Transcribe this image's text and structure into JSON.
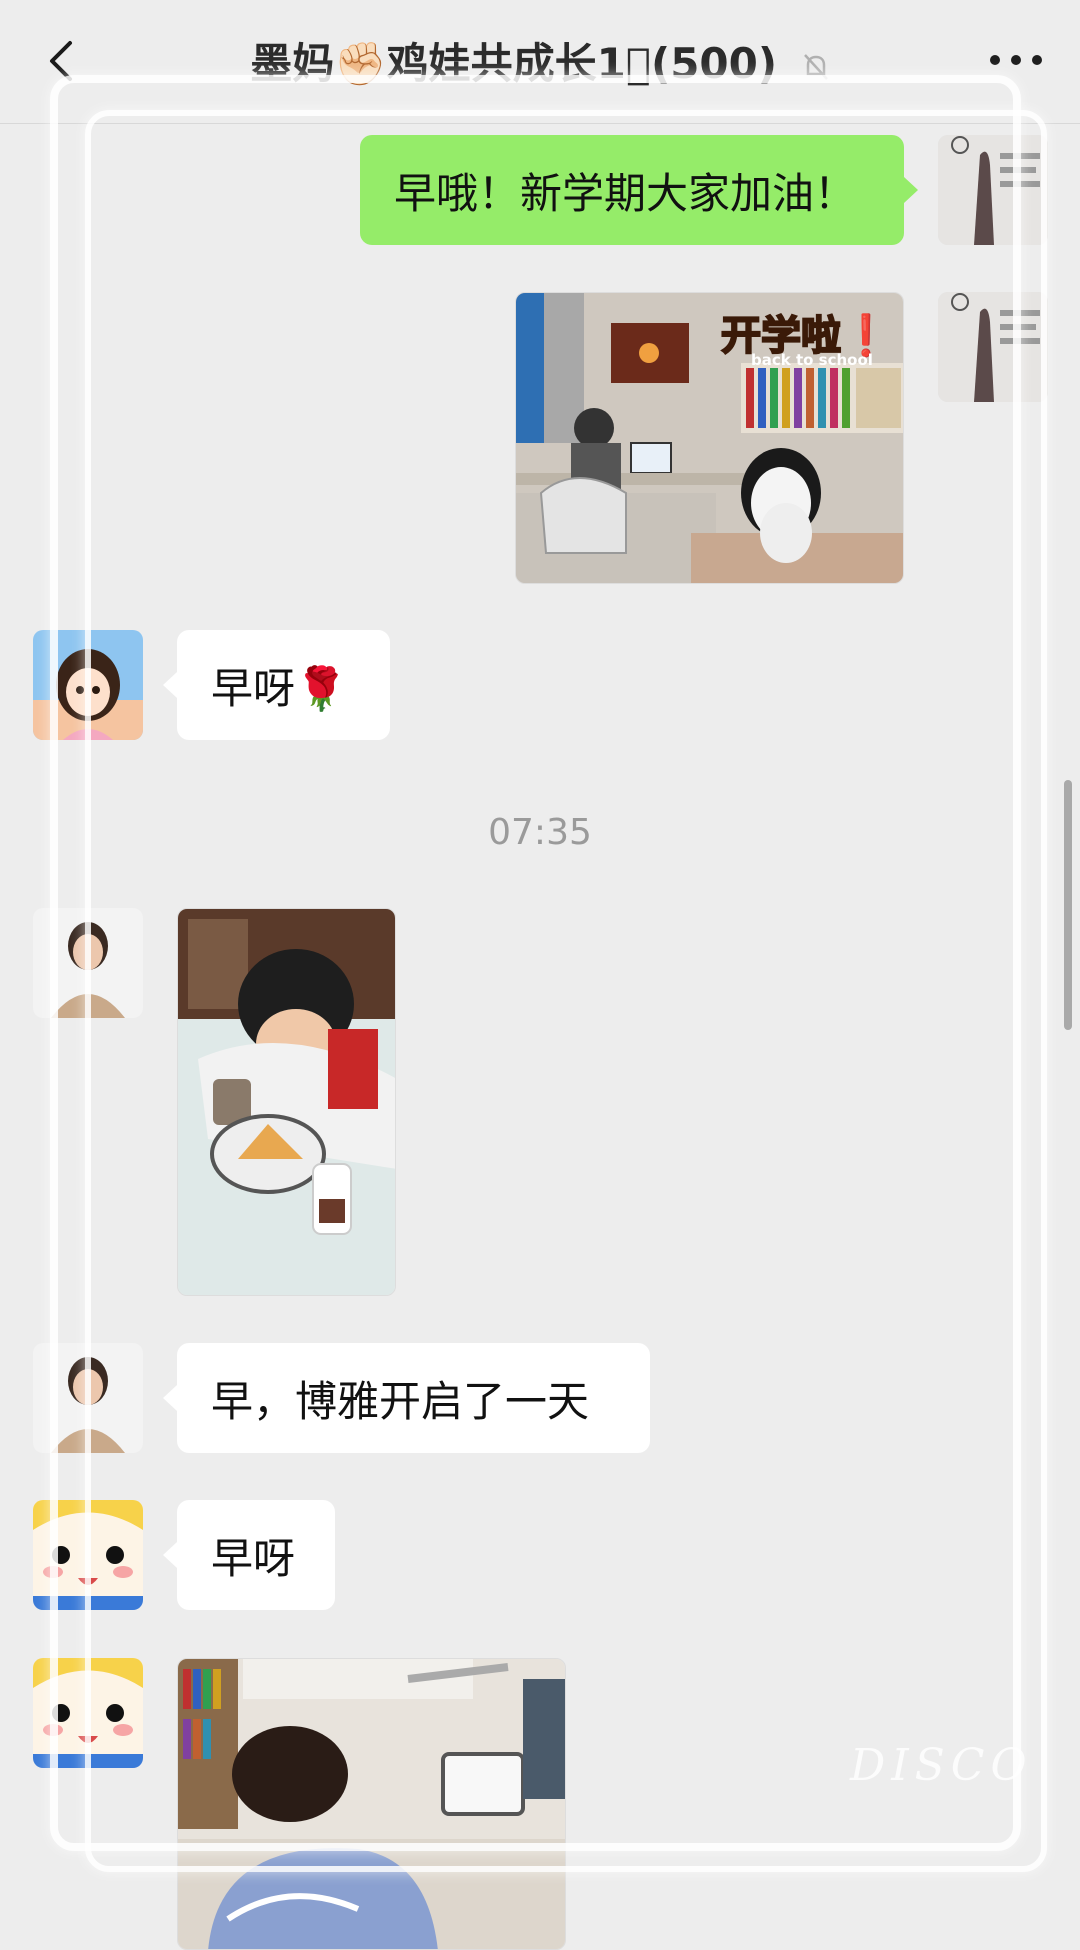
{
  "header": {
    "title": "墨妈✊🏻鸡娃共成长1⃣️(500)",
    "back_icon": "chevron-left-icon",
    "mute_icon": "bell-off-icon",
    "more_icon": "more-dots-icon"
  },
  "messages": [
    {
      "side": "right",
      "type": "text",
      "text": "早哦！新学期大家加油！"
    },
    {
      "side": "right",
      "type": "image",
      "image_text": "开学啦❗",
      "image_subtext": "back to school"
    },
    {
      "side": "left",
      "type": "text",
      "text": "早呀🌹"
    },
    {
      "side": "left",
      "type": "image"
    },
    {
      "side": "left",
      "type": "text",
      "text": "早，博雅开启了一天"
    },
    {
      "side": "left",
      "type": "text",
      "text": "早呀"
    },
    {
      "side": "left",
      "type": "image"
    }
  ],
  "timestamp": "07:35",
  "watermark": "DISCO",
  "colors": {
    "background": "#ededed",
    "right_bubble": "#95ec69",
    "left_bubble": "#ffffff"
  }
}
